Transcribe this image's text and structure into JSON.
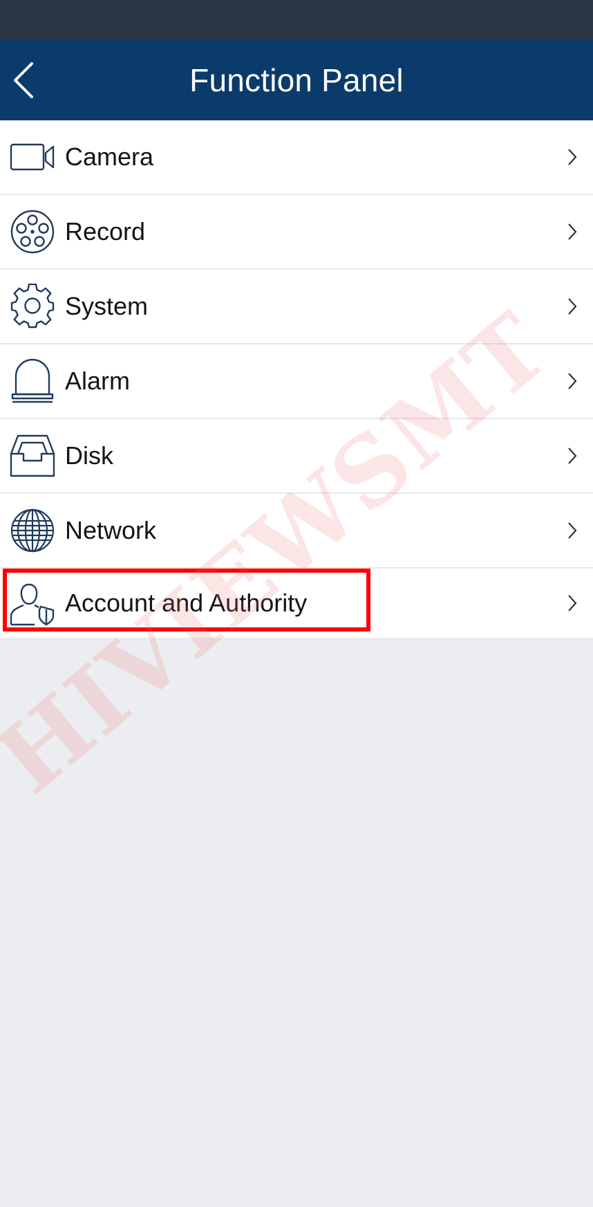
{
  "header": {
    "title": "Function Panel",
    "back_icon": "chevron-left-icon"
  },
  "menu": {
    "items": [
      {
        "label": "Camera",
        "icon": "video-camera-icon"
      },
      {
        "label": "Record",
        "icon": "film-reel-icon"
      },
      {
        "label": "System",
        "icon": "gear-icon"
      },
      {
        "label": "Alarm",
        "icon": "alarm-bell-icon"
      },
      {
        "label": "Disk",
        "icon": "disk-tray-icon"
      },
      {
        "label": "Network",
        "icon": "globe-icon"
      },
      {
        "label": "Account and Authority",
        "icon": "user-shield-icon"
      }
    ]
  },
  "watermark": {
    "text": "HIVIEWSMT"
  },
  "colors": {
    "header_bg": "#0b3b6a",
    "status_bar_bg": "#2a3447",
    "page_bg": "#ecedf0",
    "icon_stroke": "#1f3a5c",
    "highlight": "#ff0000"
  }
}
